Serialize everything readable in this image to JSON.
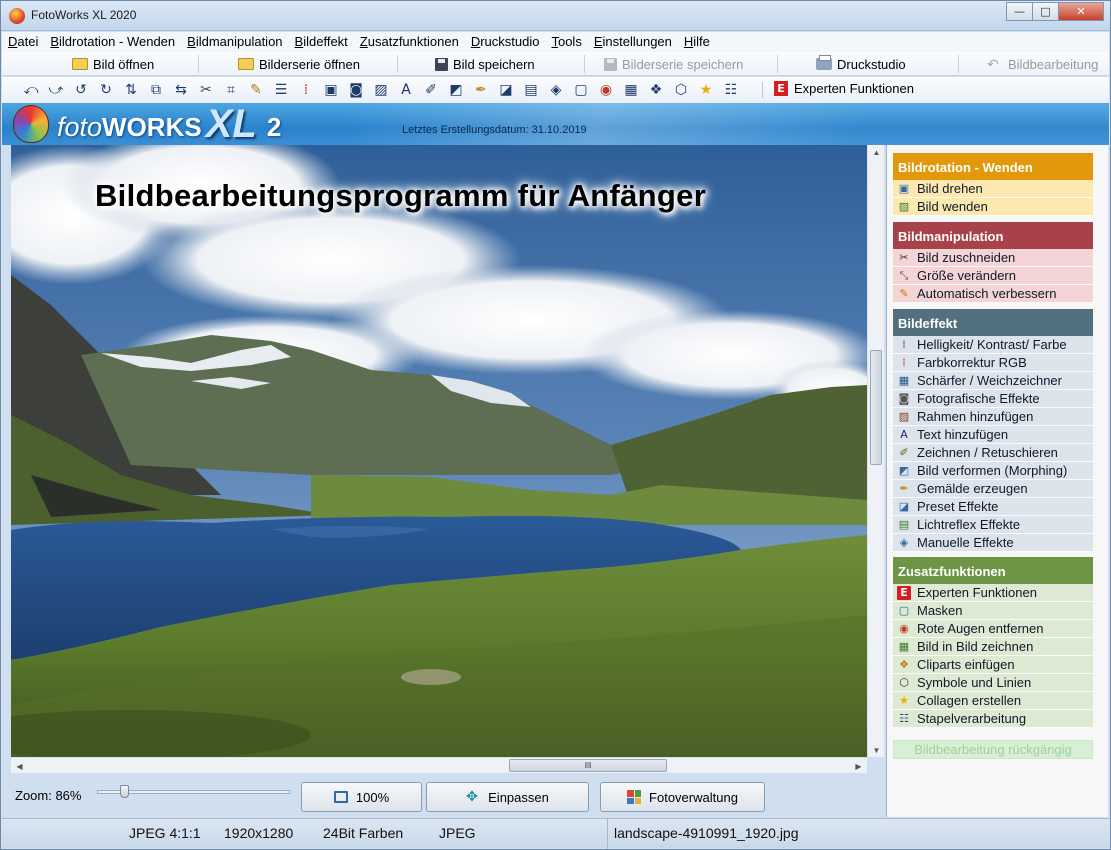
{
  "window": {
    "title": "FotoWorks XL 2020",
    "controls": [
      "minimize",
      "maximize",
      "close"
    ]
  },
  "menu": [
    {
      "label": "Datei",
      "accel": "D",
      "rest": "atei"
    },
    {
      "label": "Bildrotation - Wenden",
      "accel": "B",
      "rest": "ildrotation - Wenden"
    },
    {
      "label": "Bildmanipulation",
      "accel": "B",
      "rest": "ildmanipulation"
    },
    {
      "label": "Bildeffekt",
      "accel": "B",
      "rest": "ildeffekt"
    },
    {
      "label": "Zusatzfunktionen",
      "accel": "Z",
      "rest": "usatzfunktionen"
    },
    {
      "label": "Druckstudio",
      "accel": "D",
      "rest": "ruckstudio"
    },
    {
      "label": "Tools",
      "accel": "T",
      "rest": "ools"
    },
    {
      "label": "Einstellungen",
      "accel": "E",
      "rest": "instellungen"
    },
    {
      "label": "Hilfe",
      "accel": "H",
      "rest": "ilfe"
    }
  ],
  "toolbar1": {
    "open_image": "Bild öffnen",
    "open_series": "Bilderserie öffnen",
    "save_image": "Bild speichern",
    "save_series": "Bilderserie speichern",
    "print_studio": "Druckstudio",
    "edit": "Bildbearbeitung"
  },
  "toolbar2": {
    "icons": [
      "rotate-left-icon",
      "rotate-right-icon",
      "rotate-ccw-icon",
      "rotate-cw-icon",
      "flip-vertical-icon",
      "flip-object-icon",
      "flip-horizontal-icon",
      "scissors-icon",
      "crop-icon",
      "magic-wand-icon",
      "sliders-icon",
      "rgb-icon",
      "sharpen-icon",
      "camera-icon",
      "frame-icon",
      "text-icon",
      "draw-icon",
      "morph-icon",
      "paint-icon",
      "preset-icon",
      "lens-flare-icon",
      "manual-effects-icon",
      "mask-icon",
      "red-eye-icon",
      "picture-in-picture-icon",
      "clipart-icon",
      "shapes-icon",
      "star-icon",
      "batch-icon"
    ],
    "expert_label": "Experten Funktionen",
    "expert_badge": "E"
  },
  "banner": {
    "logo_foto": "foto",
    "logo_works": "WORKS",
    "logo_xl": "XL",
    "logo_version": "2",
    "creation_date": "Letztes Erstellungsdatum: 31.10.2019"
  },
  "image": {
    "headline": "Bildbearbeitungsprogramm für Anfänger"
  },
  "zoom": {
    "label": "Zoom: 86%",
    "percent": 86
  },
  "buttons": {
    "hundred": "100%",
    "fit": "Einpassen",
    "photo_manager": "Fotoverwaltung"
  },
  "status": {
    "format_info": "JPEG  4:1:1",
    "resolution": "1920x1280",
    "colors": "24Bit Farben",
    "type": "JPEG",
    "filename": "landscape-4910991_1920.jpg"
  },
  "panel": {
    "colors": {
      "rotation_header": "#e2980a",
      "rotation_item": "#fde9b0",
      "manipulation_header": "#a8424a",
      "manipulation_item": "#f4d4d4",
      "effect_header": "#52707e",
      "effect_item": "#dce3ea",
      "extra_header": "#6e9545",
      "extra_item": "#dde9d2"
    },
    "sections": [
      {
        "title": "Bildrotation - Wenden",
        "items": [
          {
            "label": "Bild drehen",
            "icon": "rotate-image-icon"
          },
          {
            "label": "Bild wenden",
            "icon": "flip-image-icon"
          }
        ]
      },
      {
        "title": "Bildmanipulation",
        "items": [
          {
            "label": "Bild zuschneiden",
            "icon": "scissors-icon"
          },
          {
            "label": "Größe verändern",
            "icon": "resize-icon"
          },
          {
            "label": "Automatisch verbessern",
            "icon": "magic-wand-icon"
          }
        ]
      },
      {
        "title": "Bildeffekt",
        "items": [
          {
            "label": "Helligkeit/ Kontrast/ Farbe",
            "icon": "sliders-icon"
          },
          {
            "label": "Farbkorrektur RGB",
            "icon": "rgb-icon"
          },
          {
            "label": "Schärfer / Weichzeichner",
            "icon": "sharpen-icon"
          },
          {
            "label": "Fotografische Effekte",
            "icon": "camera-icon"
          },
          {
            "label": "Rahmen hinzufügen",
            "icon": "frame-icon"
          },
          {
            "label": "Text hinzufügen",
            "icon": "text-icon"
          },
          {
            "label": "Zeichnen / Retuschieren",
            "icon": "draw-icon"
          },
          {
            "label": "Bild verformen (Morphing)",
            "icon": "morph-icon"
          },
          {
            "label": "Gemälde erzeugen",
            "icon": "paint-icon"
          },
          {
            "label": "Preset Effekte",
            "icon": "preset-icon"
          },
          {
            "label": "Lichtreflex Effekte",
            "icon": "lens-flare-icon"
          },
          {
            "label": "Manuelle Effekte",
            "icon": "manual-effects-icon"
          }
        ]
      },
      {
        "title": "Zusatzfunktionen",
        "items": [
          {
            "label": "Experten Funktionen",
            "icon": "expert-icon"
          },
          {
            "label": "Masken",
            "icon": "mask-icon"
          },
          {
            "label": "Rote Augen entfernen",
            "icon": "red-eye-icon"
          },
          {
            "label": "Bild in Bild zeichnen",
            "icon": "picture-in-picture-icon"
          },
          {
            "label": "Cliparts einfügen",
            "icon": "clipart-icon"
          },
          {
            "label": "Symbole und Linien",
            "icon": "shapes-icon"
          },
          {
            "label": "Collagen erstellen",
            "icon": "star-icon"
          },
          {
            "label": "Stapelverarbeitung",
            "icon": "batch-icon"
          }
        ]
      }
    ],
    "undo_label": "Bildbearbeitung rückgängig"
  }
}
